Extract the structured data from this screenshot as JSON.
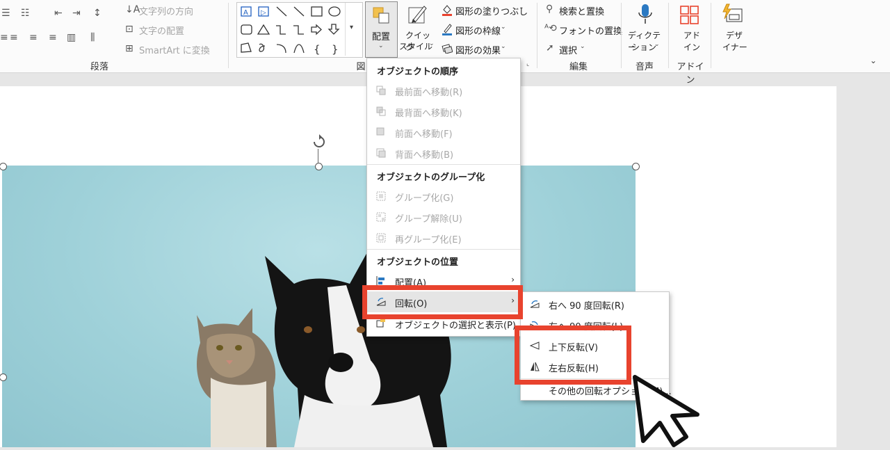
{
  "ribbon": {
    "paragraph": {
      "text_direction": "文字列の方向",
      "align_text": "文字の配置",
      "smartart": "SmartArt に変換",
      "group_label": "段落"
    },
    "drawing": {
      "arrange_label": "配置",
      "quick_styles_label_1": "クイック",
      "quick_styles_label_2": "スタイル",
      "shape_fill": "図形の塗りつぶし",
      "shape_outline": "図形の枠線",
      "shape_effects": "図形の効果",
      "group_label": "図"
    },
    "editing": {
      "find_replace": "検索と置換",
      "font_replace": "フォントの置換",
      "select": "選択",
      "group_label": "編集"
    },
    "voice": {
      "dictate_1": "ディクテー",
      "dictate_2": "ション",
      "group_label": "音声"
    },
    "addins": {
      "addins_1": "アド",
      "addins_2": "イン",
      "group_label": "アドイン"
    },
    "designer": {
      "designer_1": "デザ",
      "designer_2": "イナー"
    }
  },
  "arrange_menu": {
    "order_header": "オブジェクトの順序",
    "bring_to_front": "最前面へ移動(R)",
    "send_to_back": "最背面へ移動(K)",
    "bring_forward": "前面へ移動(F)",
    "send_backward": "背面へ移動(B)",
    "group_header": "オブジェクトのグループ化",
    "group": "グループ化(G)",
    "ungroup": "グループ解除(U)",
    "regroup": "再グループ化(E)",
    "position_header": "オブジェクトの位置",
    "align": "配置(A)",
    "rotate": "回転(O)",
    "selection_pane": "オブジェクトの選択と表示(P)..."
  },
  "rotate_menu": {
    "rotate_right": "右へ 90 度回転(R)",
    "rotate_left": "左へ 90 度回転(L)",
    "flip_vertical": "上下反転(V)",
    "flip_horizontal": "左右反転(H)",
    "more_options": "その他の回転オプション(M)..."
  },
  "colors": {
    "highlight": "#e8432e",
    "photo_bg": "#9fd1d9"
  }
}
